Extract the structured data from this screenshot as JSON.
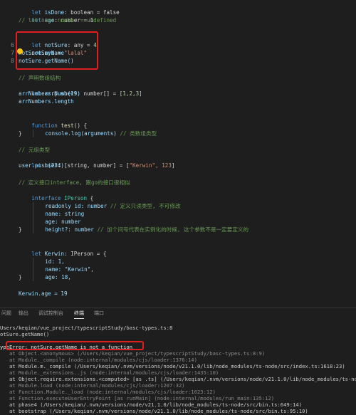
{
  "editor": {
    "line_markers": {
      "l6": "6",
      "l7": "7",
      "l8": "8"
    },
    "lines": {
      "l1": {
        "kw": "let",
        "name": "isDone",
        "rest": ": boolean = false"
      },
      "l2": {
        "kw": "let",
        "name": "age",
        "rest": ": number = 1"
      },
      "l3": {
        "comment": "// let num: number = undefined"
      },
      "l5": {
        "kw": "let",
        "name": "notSure",
        "mid": ": any = ",
        "val": "4"
      },
      "l6": {
        "name": "notSure",
        "mid": " = ",
        "val": "\"lalal\""
      },
      "l7": {
        "text": "notSure.myName"
      },
      "l8": {
        "text": "notSure.getName()"
      },
      "l10": {
        "comment": "// 声明数组结构"
      },
      "l11": {
        "kw": "let",
        "name": "arrNumbers",
        "mid": ": number[] = ",
        "val": "[1,2,3]"
      },
      "l12": {
        "text": "arrNumbers.push(19)"
      },
      "l13": {
        "text": "arrNumbers.length"
      },
      "l15": {
        "kw": "function",
        "name": "test",
        "rest": "() {"
      },
      "l16": {
        "text": "console.log(arguments)",
        "comment": " // 类数组类型"
      },
      "l17": {
        "text": "}"
      },
      "l19": {
        "comment": "// 元组类型"
      },
      "l20": {
        "kw": "let",
        "name": "user",
        "mid": ": [string, number] = [",
        "val": "\"Kerwin\", 123",
        "end": "]"
      },
      "l21": {
        "text": "user.push(234)"
      },
      "l23": {
        "comment": "// 定义接口interface, 跟go的接口很相似"
      },
      "l24": {
        "kw": "interface",
        "name": "IPerson",
        "rest": " {"
      },
      "l25": {
        "text": "readonly id: number",
        "comment": " // 定义只读类型, 不可修改"
      },
      "l26": {
        "text": "name: string"
      },
      "l27": {
        "text": "age: number"
      },
      "l28": {
        "text": "height?: number",
        "comment": " // 加个问号代表在实例化的时候, 这个参数不是一定要定义的"
      },
      "l29": {
        "text": "}"
      },
      "l31": {
        "kw": "let",
        "name": "Kerwin",
        "rest": ": IPerson = {"
      },
      "l32": {
        "text": "id: 1,"
      },
      "l33": {
        "text": "name: \"Kerwin\","
      },
      "l34": {
        "text": "age: 18,"
      },
      "l35": {
        "text": "}"
      },
      "l37": {
        "text": "Kerwin.age = 19"
      }
    }
  },
  "panel": {
    "tabs": [
      "问题",
      "输出",
      "调试控制台",
      "终端",
      "端口"
    ],
    "active_tab": "终端"
  },
  "terminal": {
    "lines": [
      "Users/keqian/vue_project/typescriptStudy/basc-types.ts:8",
      "otSure.getName()",
      "",
      "ypeError: notSure.getName is not a function",
      "   at Object.<anonymous> (/Users/keqian/vue_project/typescriptStudy/basc-types.ts:8:9)",
      "   at Module._compile (node:internal/modules/cjs/loader:1376:14)",
      "   at Module.m._compile (/Users/keqian/.nvm/versions/node/v21.1.0/lib/node_modules/ts-node/src/index.ts:1618:23)",
      "   at Module._extensions..js (node:internal/modules/cjs/loader:1435:10)",
      "   at Object.require.extensions.<computed> [as .ts] (/Users/keqian/.nvm/versions/node/v21.1.0/lib/node_modules/ts-node",
      "   at Module.load (node:internal/modules/cjs/loader:1207:32)",
      "   at Function.Module._load (node:internal/modules/cjs/loader:1023:12)",
      "   at Function.executeUserEntryPoint [as runMain] (node:internal/modules/run_main:135:12)",
      "   at phase4 (/Users/keqian/.nvm/versions/node/v21.1.0/lib/node_modules/ts-node/src/bin.ts:649:14)",
      "   at bootstrap (/Users/keqian/.nvm/versions/node/v21.1.0/lib/node_modules/ts-node/src/bin.ts:95:10)"
    ]
  },
  "colors": {
    "highlight_border": "#e02020",
    "background": "#1e1e1e"
  }
}
